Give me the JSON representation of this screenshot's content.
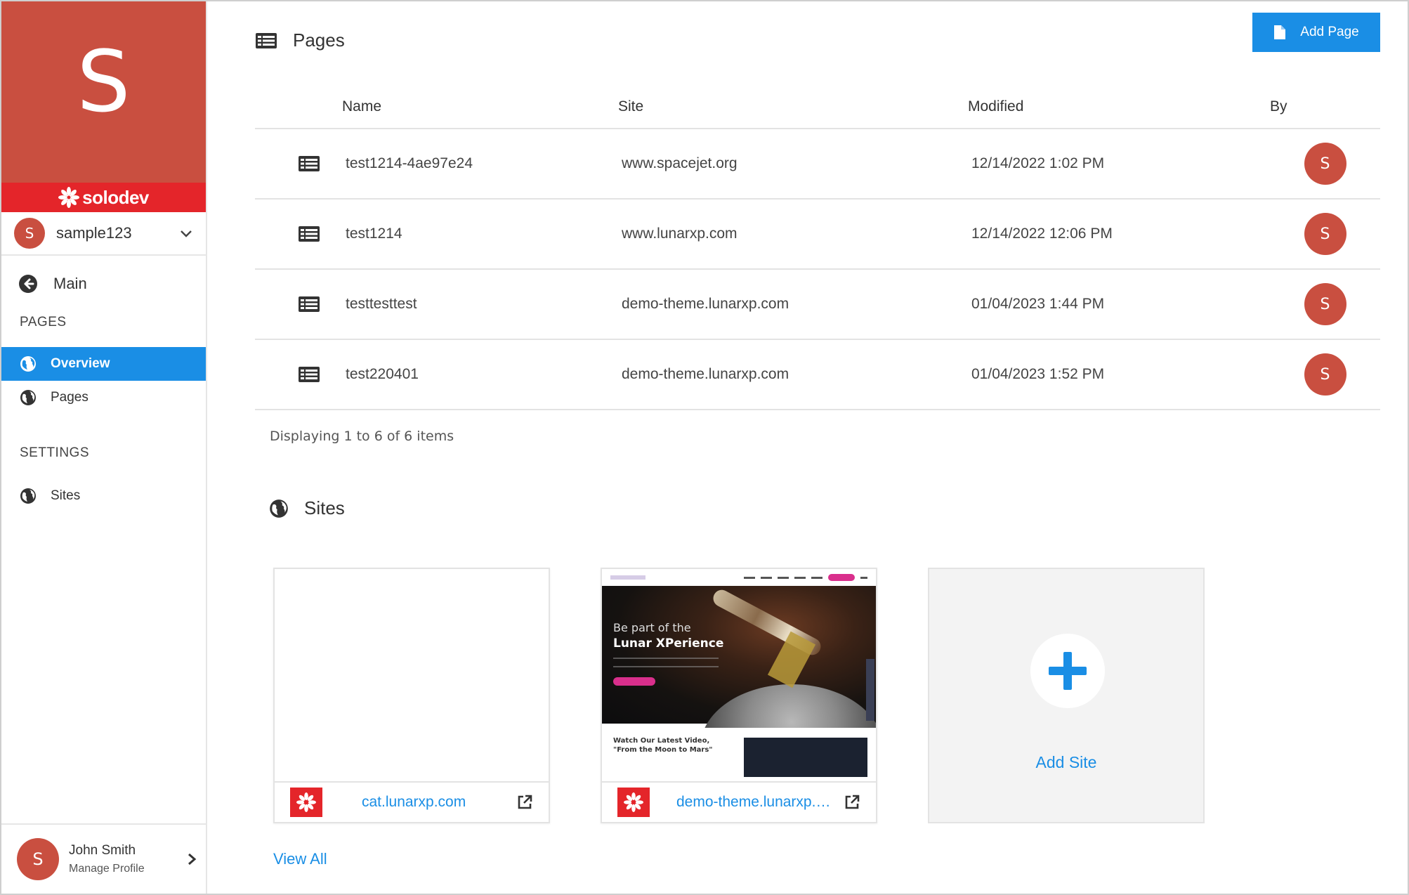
{
  "brand": {
    "letter": "S",
    "name": "solodev",
    "tile_color": "#c94f40",
    "bar_color": "#e4252a"
  },
  "site_switcher": {
    "avatar": "S",
    "label": "sample123",
    "icon": "chevron-down-icon"
  },
  "nav": {
    "main_label": "Main",
    "pages_section": "PAGES",
    "items": [
      {
        "label": "Overview",
        "icon": "globe-icon",
        "active": true
      },
      {
        "label": "Pages",
        "icon": "globe-icon",
        "active": false
      }
    ],
    "settings_section": "SETTINGS",
    "settings_items": [
      {
        "label": "Sites",
        "icon": "globe-icon"
      }
    ]
  },
  "profile": {
    "avatar": "S",
    "name": "John Smith",
    "sub": "Manage Profile"
  },
  "pages_section": {
    "title": "Pages",
    "add_button": "Add Page",
    "columns": [
      "Name",
      "Site",
      "Modified",
      "By"
    ],
    "rows": [
      {
        "name": "test1214-4ae97e24",
        "site": "www.spacejet.org",
        "modified": "12/14/2022 1:02 PM",
        "by": "S"
      },
      {
        "name": "test1214",
        "site": "www.lunarxp.com",
        "modified": "12/14/2022 12:06 PM",
        "by": "S"
      },
      {
        "name": "testtesttest",
        "site": "demo-theme.lunarxp.com",
        "modified": "01/04/2023 1:44 PM",
        "by": "S"
      },
      {
        "name": "test220401",
        "site": "demo-theme.lunarxp.com",
        "modified": "01/04/2023 1:52 PM",
        "by": "S"
      }
    ],
    "displaying": "Displaying 1 to 6 of 6 items"
  },
  "sites_section": {
    "title": "Sites",
    "cards": [
      {
        "link": "cat.lunarxp.com"
      },
      {
        "link": "demo-theme.lunarxp.c…",
        "thumb": {
          "line1": "Be part of the",
          "line2": "Lunar XPerience",
          "video_text": "Watch Our Latest Video, \"From the Moon to Mars\""
        }
      }
    ],
    "add_site": "Add Site",
    "view_all": "View All"
  },
  "colors": {
    "accent": "#1a8ee5",
    "avatar": "#c94f40"
  }
}
